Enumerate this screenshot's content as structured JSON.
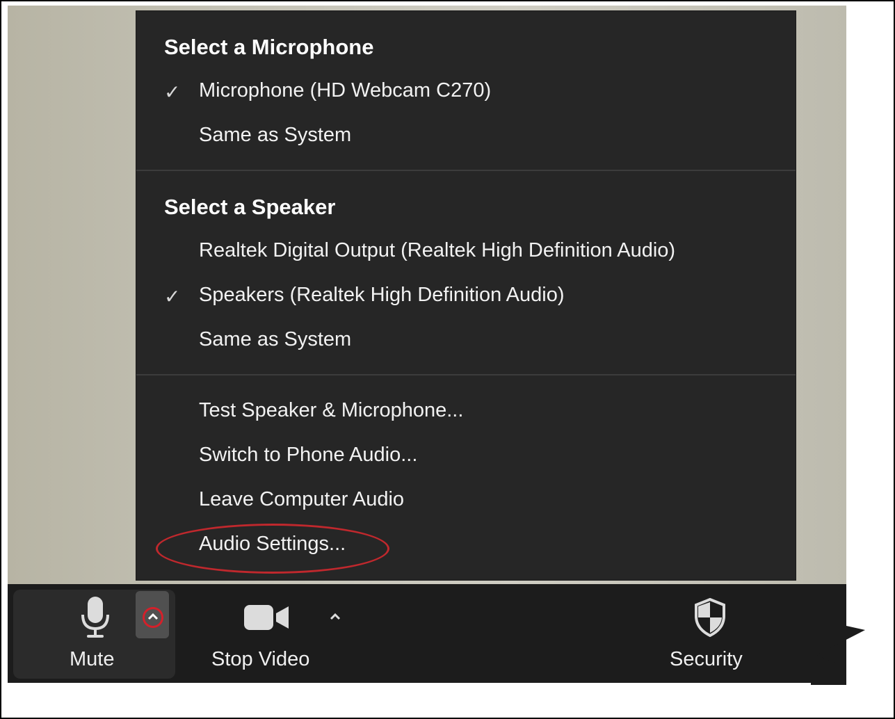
{
  "menu": {
    "microphone_header": "Select a Microphone",
    "microphone_items": [
      {
        "label": "Microphone (HD Webcam C270)",
        "checked": true
      },
      {
        "label": "Same as System",
        "checked": false
      }
    ],
    "speaker_header": "Select a Speaker",
    "speaker_items": [
      {
        "label": "Realtek Digital Output (Realtek High Definition Audio)",
        "checked": false
      },
      {
        "label": "Speakers (Realtek High Definition Audio)",
        "checked": true
      },
      {
        "label": "Same as System",
        "checked": false
      }
    ],
    "action_items": [
      {
        "label": "Test Speaker & Microphone..."
      },
      {
        "label": "Switch to Phone Audio..."
      },
      {
        "label": "Leave Computer Audio"
      },
      {
        "label": "Audio Settings..."
      }
    ],
    "check_glyph": "✓"
  },
  "toolbar": {
    "mute_label": "Mute",
    "stop_video_label": "Stop Video",
    "security_label": "Security",
    "caret_glyph": "^"
  },
  "colors": {
    "menu_bg": "#262626",
    "toolbar_bg": "#1c1c1c",
    "highlight": "#c0282d"
  }
}
